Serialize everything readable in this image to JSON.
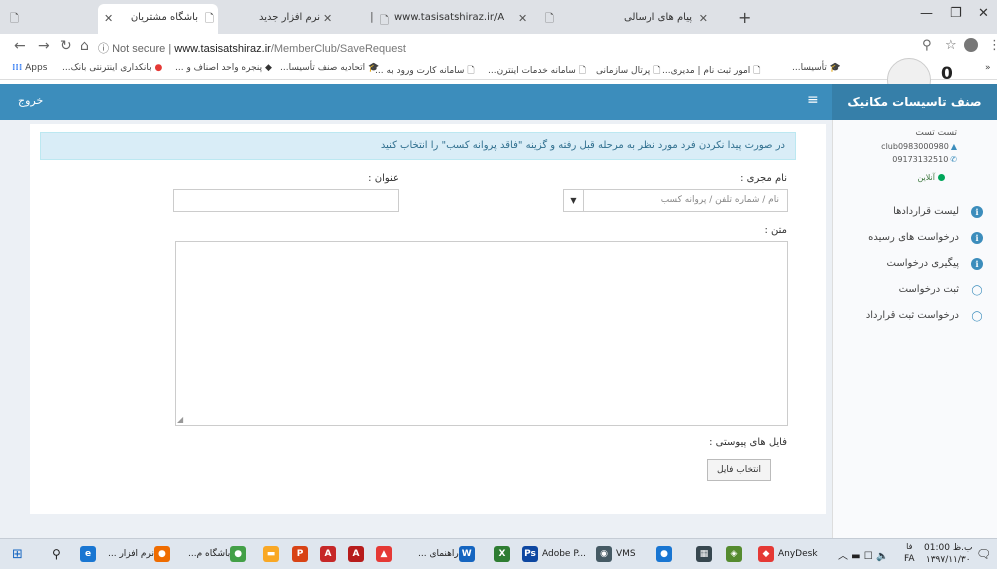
{
  "browser": {
    "tabs": [
      {
        "title": "باشگاه مشتریان",
        "active": true
      },
      {
        "title": "نرم افزار جدید",
        "active": false
      },
      {
        "title": "www.tasisatshiraz.ir/Accounting/",
        "active": false
      },
      {
        "title": "پیام های ارسالی",
        "active": false
      }
    ],
    "address": {
      "security": "Not secure",
      "domain": "www.tasisatshiraz.ir",
      "path": "/MemberClub/SaveRequest"
    },
    "bookmarks": [
      "Apps",
      "بانکداری اینترنتی بانک...",
      "پنجره واحد اصناف و ...",
      "اتحادیه صنف تأسیسا...",
      "سامانه کارت ورود به ...",
      "سامانه خدمات اینترن...",
      "پرتال سازمانی",
      "امور ثبت نام | مدیری...",
      "تأسیسا..."
    ],
    "notification_count": "0"
  },
  "app": {
    "brand": "صنف تاسیسات مکانیک",
    "logout": "خروج"
  },
  "user": {
    "name": "تست تست",
    "username": "club0983000980",
    "phone": "09173132510",
    "status": "آنلاین"
  },
  "sidebar": {
    "items": [
      {
        "label": "لیست قراردادها",
        "icon": "info-icon"
      },
      {
        "label": "درخواست های رسیده",
        "icon": "info-icon"
      },
      {
        "label": "پیگیری درخواست",
        "icon": "info-icon"
      },
      {
        "label": "ثبت درخواست",
        "icon": "chat-icon"
      },
      {
        "label": "درخواست ثبت قرارداد",
        "icon": "chat-icon"
      }
    ]
  },
  "form": {
    "alert": "در صورت پیدا نکردن فرد مورد نظر به مرحله قبل رفته و گزینه \"فاقد پروانه کسب\" را انتخاب کنید",
    "executor_label": "نام مجری :",
    "executor_placeholder": "نام / شماره تلفن / پروانه کسب",
    "title_label": "عنوان :",
    "title_value": "",
    "body_label": "متن :",
    "body_value": "",
    "attachments_label": "فایل های پیوستی :",
    "choose_file": "انتخاب فایل"
  },
  "taskbar": {
    "items": [
      "نرم افزار ...",
      "باشگاه م...",
      "راهنمای ...",
      "Adobe P...",
      "VMS",
      "AnyDesk"
    ],
    "lang": "FA",
    "time": "01:00 ب.ظ",
    "date": "۱۳۹۷/۱۱/۳۰"
  }
}
